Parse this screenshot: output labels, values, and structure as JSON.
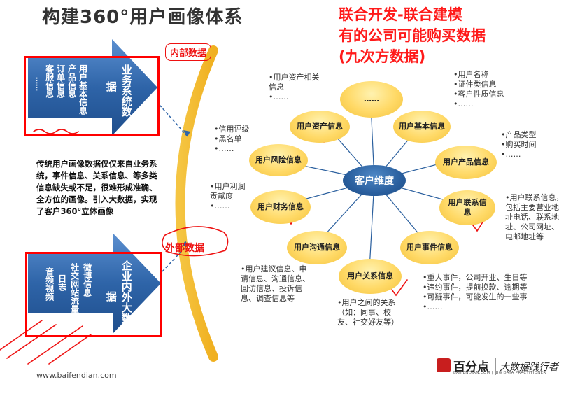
{
  "title": "构建360°用户画像体系",
  "red_note": [
    "联合开发-联合建模",
    "有的公司可能购买数据",
    "(九次方数据)"
  ],
  "inner_label": "内部数据",
  "outer_label": "外部数据",
  "top_arrow": {
    "columns": [
      "用户基本信息",
      "产品信息",
      "订单信息",
      "客服信息"
    ],
    "ellipsis": "……",
    "middle": "据",
    "right": "业务系统数"
  },
  "bottom_arrow": {
    "columns": [
      "微博信息",
      "社交网站流量",
      "日志",
      "音频视频"
    ],
    "middle": "据",
    "right": "企业内外大数"
  },
  "paragraph": "传统用户画像数据仅仅来自业务系统，事件信息、关系信息、等多类信息缺失或不足，很难形成准确、全方位的画像。引入大数据，实现了客户360°立体画像",
  "center": "客户维度",
  "nodes": {
    "top": "……",
    "asset": "用户资产信息",
    "basic": "用户基本信息",
    "product": "用户产品信息",
    "risk": "用户风险信息",
    "contact": "用户联系信息",
    "finance": "用户财务信息",
    "event": "用户事件信息",
    "comm": "用户沟通信息",
    "relation": "用户关系信息"
  },
  "notes": {
    "asset": [
      "•用户资产相关",
      "信息",
      "•……"
    ],
    "basic": [
      "•用户名称",
      "•证件类信息",
      "•客户性质信息",
      "•……"
    ],
    "product": [
      "•产品类型",
      "•购买时间",
      "•……"
    ],
    "risk": [
      "•信用评级",
      "•黑名单",
      "•……"
    ],
    "contact": [
      "•用户联系信息，",
      "包括主要营业地",
      "址电话、联系地",
      "址、公司网址、",
      "电邮地址等"
    ],
    "finance": [
      "•用户利润",
      "贡献度",
      "•……"
    ],
    "event": [
      "•重大事件，公司开业、生日等",
      "•违约事件，提前换款、逾期等",
      "•可疑事件，可能发生的一些事",
      "•……"
    ],
    "comm": [
      "•用户建议信息、申",
      "请信息、沟通信息、",
      "回访信息、投诉信",
      "息、调查信息等"
    ],
    "relation": [
      "•用户之间的关系",
      "（如：同事、校",
      "友、社交好友等）"
    ]
  },
  "footer": "www.baifendian.com",
  "logo": {
    "name": "百分点",
    "sub": "BAIFENDIAN.COM | BIG DATA PRACTITIONER",
    "tagline": "大数据践行者"
  },
  "colors": {
    "arrow_blue": "#2e64a8",
    "node_yellow": "#ffd966",
    "center_blue": "#2a5f9e",
    "annotation_red": "#ff0000"
  }
}
